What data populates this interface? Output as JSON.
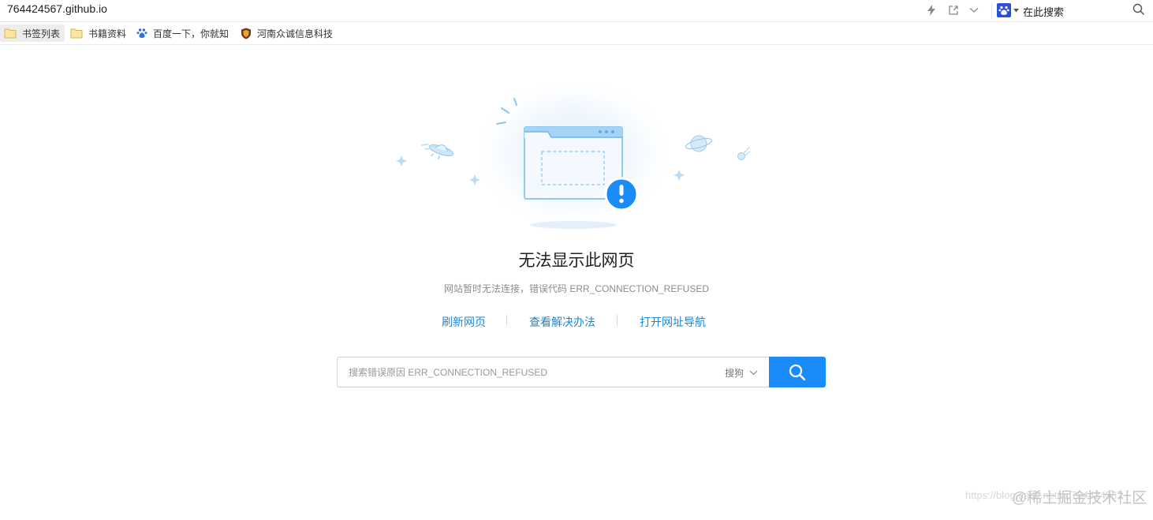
{
  "address_bar": {
    "url": "764424567.github.io",
    "icons": [
      "lightning-icon",
      "share-icon",
      "chevron-down-icon"
    ],
    "search_engine_icon": "baidu-paw-icon",
    "search_placeholder": "在此搜索",
    "search_icon": "magnifier-icon"
  },
  "bookmarks": [
    {
      "label": "书签列表",
      "icon": "folder-icon"
    },
    {
      "label": "书籍资料",
      "icon": "folder-icon"
    },
    {
      "label": "百度一下，你就知",
      "icon": "baidu-paw-icon"
    },
    {
      "label": "河南众诚信息科技",
      "icon": "shield-logo-icon"
    }
  ],
  "error": {
    "title": "无法显示此网页",
    "subtitle": "网站暂时无法连接，错误代码 ERR_CONNECTION_REFUSED",
    "actions": [
      {
        "label": "刷新网页"
      },
      {
        "label": "查看解决办法"
      },
      {
        "label": "打开网址导航"
      }
    ],
    "illustration_icons": [
      "browser-window-icon",
      "exclamation-badge-icon",
      "ufo-icon",
      "planet-icon",
      "comet-icon",
      "sparkle-icon"
    ]
  },
  "search": {
    "placeholder": "搜索错误原因 ERR_CONNECTION_REFUSED",
    "engine": "搜狗",
    "button_icon": "magnifier-icon"
  },
  "watermark": {
    "url_text": "https://blog.csdn.net/qq764424567",
    "brand_text": "@稀土掘金技术社区"
  },
  "colors": {
    "accent": "#1a8cfa",
    "link": "#1a87d6",
    "illustration": "#6cb7ee"
  }
}
